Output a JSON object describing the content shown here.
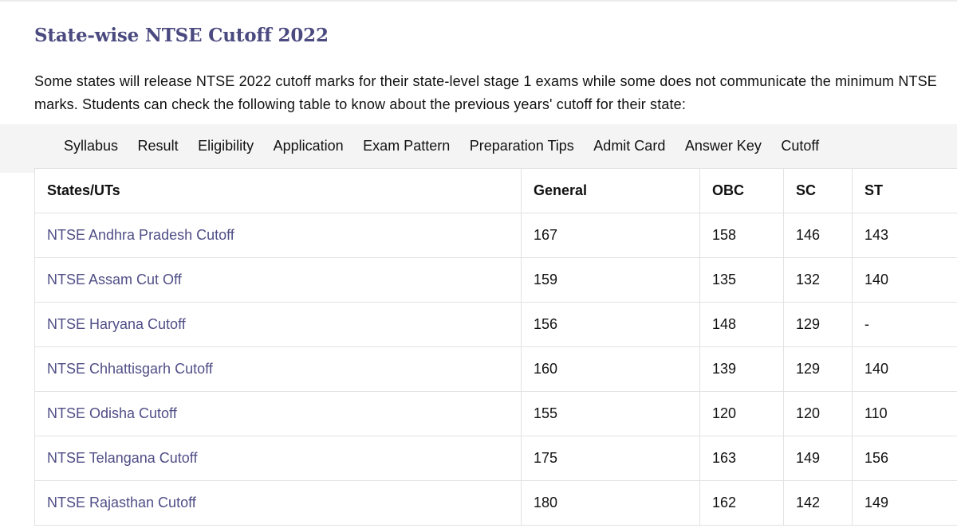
{
  "heading": "State-wise NTSE Cutoff 2022",
  "intro": "Some states will release NTSE 2022 cutoff marks for their state-level stage 1 exams while some does not communicate the minimum NTSE marks. Students can check the following table to know about the previous years' cutoff for their state:",
  "nav": {
    "items": [
      "Syllabus",
      "Result",
      "Eligibility",
      "Application",
      "Exam Pattern",
      "Preparation Tips",
      "Admit Card",
      "Answer Key",
      "Cutoff"
    ]
  },
  "table": {
    "headers": [
      "States/UTs",
      "General",
      "OBC",
      "SC",
      "ST"
    ],
    "rows": [
      [
        "NTSE Andhra Pradesh Cutoff",
        "167",
        "158",
        "146",
        "143"
      ],
      [
        "NTSE Assam Cut Off",
        "159",
        "135",
        "132",
        "140"
      ],
      [
        "NTSE Haryana Cutoff",
        "156",
        "148",
        "129",
        "-"
      ],
      [
        "NTSE Chhattisgarh Cutoff",
        "160",
        "139",
        "129",
        "140"
      ],
      [
        "NTSE Odisha Cutoff",
        "155",
        "120",
        "120",
        "110"
      ],
      [
        "NTSE Telangana Cutoff",
        "175",
        "163",
        "149",
        "156"
      ],
      [
        "NTSE Rajasthan Cutoff",
        "180",
        "162",
        "142",
        "149"
      ]
    ]
  },
  "colors": {
    "heading": "#4b4a80",
    "link": "#4f4e86",
    "tabbar_bg": "#f4f4f4",
    "border": "#e2e2e2"
  }
}
